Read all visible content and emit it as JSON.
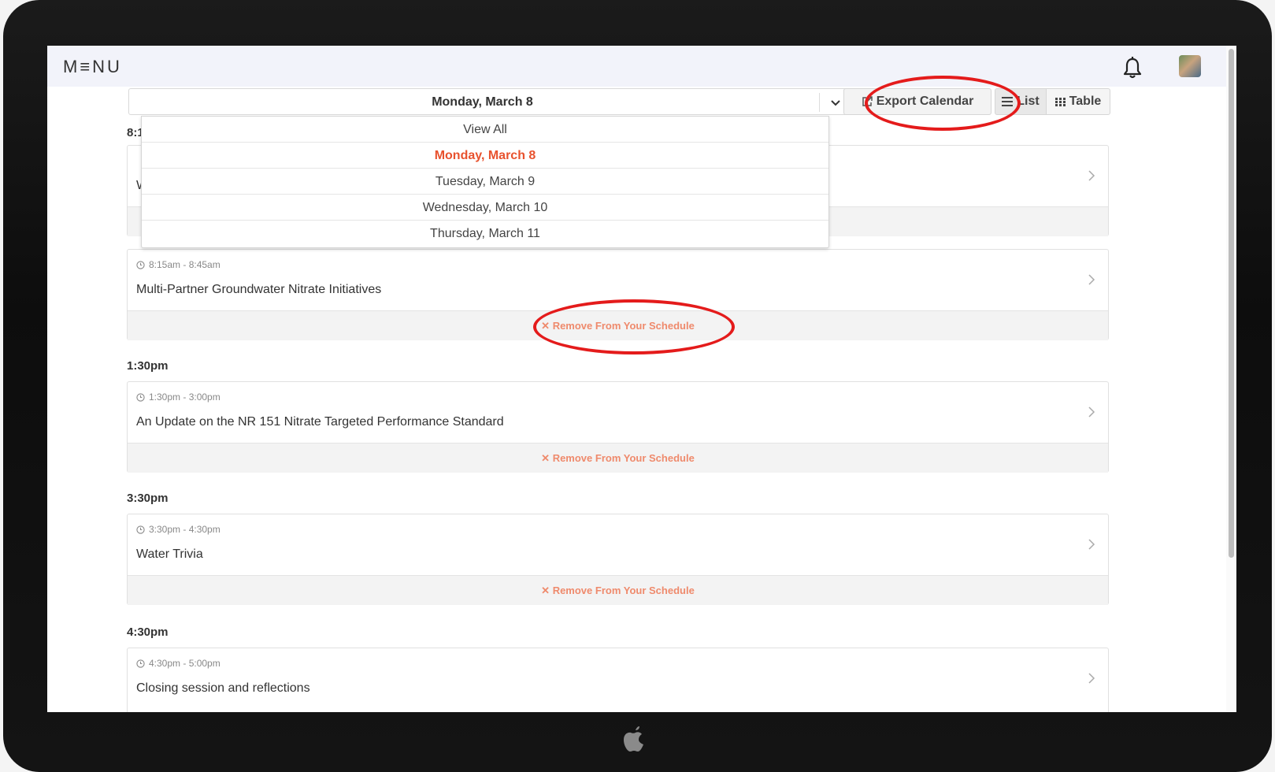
{
  "header": {
    "brand": "M≡NU"
  },
  "toolbar": {
    "date_selected": "Monday, March 8",
    "export_label": "Export Calendar",
    "list_label": "List",
    "table_label": "Table"
  },
  "dropdown": {
    "options": [
      "View All",
      "Monday, March 8",
      "Tuesday, March 9",
      "Wednesday, March 10",
      "Thursday, March 11"
    ],
    "selected": "Monday, March 8"
  },
  "hidden_group_time": "8:1",
  "hidden_card_title": "W",
  "sessions": [
    {
      "group_time": "",
      "range": "8:15am - 8:45am",
      "title": "Multi-Partner Groundwater Nitrate Initiatives",
      "action": "Remove From Your Schedule"
    },
    {
      "group_time": "1:30pm",
      "range": "1:30pm - 3:00pm",
      "title": "An Update on the NR 151 Nitrate Targeted Performance Standard",
      "action": "Remove From Your Schedule"
    },
    {
      "group_time": "3:30pm",
      "range": "3:30pm - 4:30pm",
      "title": "Water Trivia",
      "action": "Remove From Your Schedule"
    },
    {
      "group_time": "4:30pm",
      "range": "4:30pm - 5:00pm",
      "title": "Closing session and reflections",
      "action": "Remove From Your Schedule"
    }
  ],
  "colors": {
    "accent": "#e8522e",
    "remove_text": "#ef8a6c",
    "highlight": "#e41b1b"
  }
}
